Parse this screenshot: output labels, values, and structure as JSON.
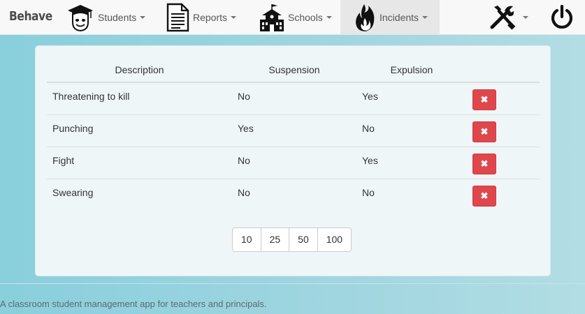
{
  "brand": "Behave",
  "nav": {
    "students": "Students",
    "reports": "Reports",
    "schools": "Schools",
    "incidents": "Incidents",
    "tools_icon": "tools-icon",
    "power_icon": "power-icon"
  },
  "table": {
    "headers": [
      "Description",
      "Suspension",
      "Expulsion"
    ],
    "rows": [
      {
        "description": "Threatening to kill",
        "suspension": "No",
        "expulsion": "Yes"
      },
      {
        "description": "Punching",
        "suspension": "Yes",
        "expulsion": "No"
      },
      {
        "description": "Fight",
        "suspension": "No",
        "expulsion": "Yes"
      },
      {
        "description": "Swearing",
        "suspension": "No",
        "expulsion": "No"
      }
    ],
    "delete_glyph": "✖"
  },
  "pager": [
    "10",
    "25",
    "50",
    "100"
  ],
  "footer": "A classroom student management app for teachers and principals.",
  "colors": {
    "delete": "#e0474c",
    "background": "#9fd5df",
    "navbar": "#f8f8f8"
  }
}
